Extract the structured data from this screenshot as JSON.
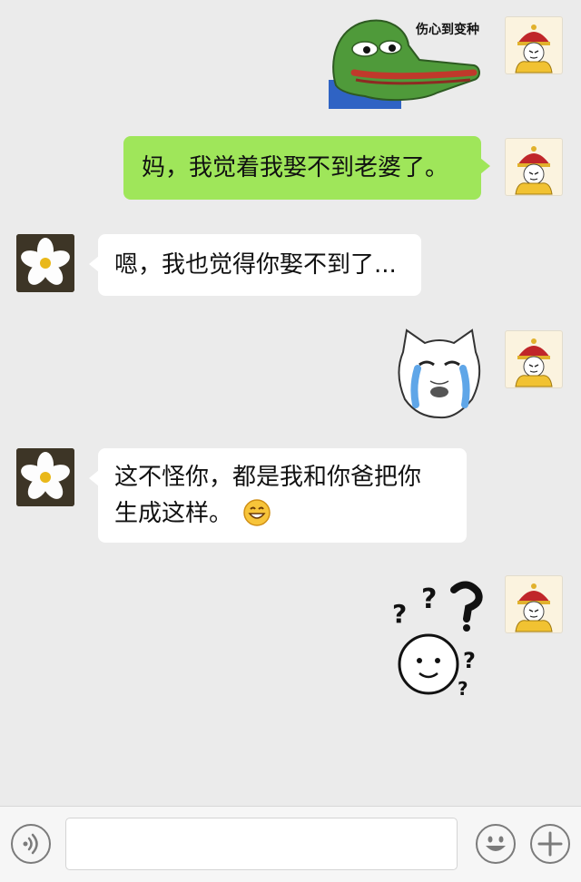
{
  "messages": [
    {
      "id": 1,
      "sender": "me",
      "type": "sticker",
      "sticker": "sad-frog-crocodile-sticker",
      "caption": "伤心到变种"
    },
    {
      "id": 2,
      "sender": "me",
      "type": "text",
      "text": "妈，我觉着我娶不到老婆了。"
    },
    {
      "id": 3,
      "sender": "other",
      "type": "text",
      "text": "嗯，我也觉得你娶不到了..."
    },
    {
      "id": 4,
      "sender": "me",
      "type": "sticker",
      "sticker": "crying-cat-face-sticker"
    },
    {
      "id": 5,
      "sender": "other",
      "type": "text",
      "line1": "这不怪你，都是我和你爸把你",
      "line2": "生成这样。",
      "trailing_emoji": "grinning-emoji"
    },
    {
      "id": 6,
      "sender": "me",
      "type": "sticker",
      "sticker": "confused-face-question-marks-sticker"
    }
  ],
  "avatars": {
    "me": "emperor-avatar",
    "other": "white-flower-avatar"
  },
  "input_bar": {
    "voice_icon": "voice-icon",
    "emoji_icon": "emoji-face-icon",
    "plus_icon": "plus-icon",
    "input_value": ""
  },
  "colors": {
    "background": "#ebebeb",
    "my_bubble": "#9fe65a",
    "their_bubble": "#ffffff",
    "input_bar": "#f6f6f6"
  }
}
